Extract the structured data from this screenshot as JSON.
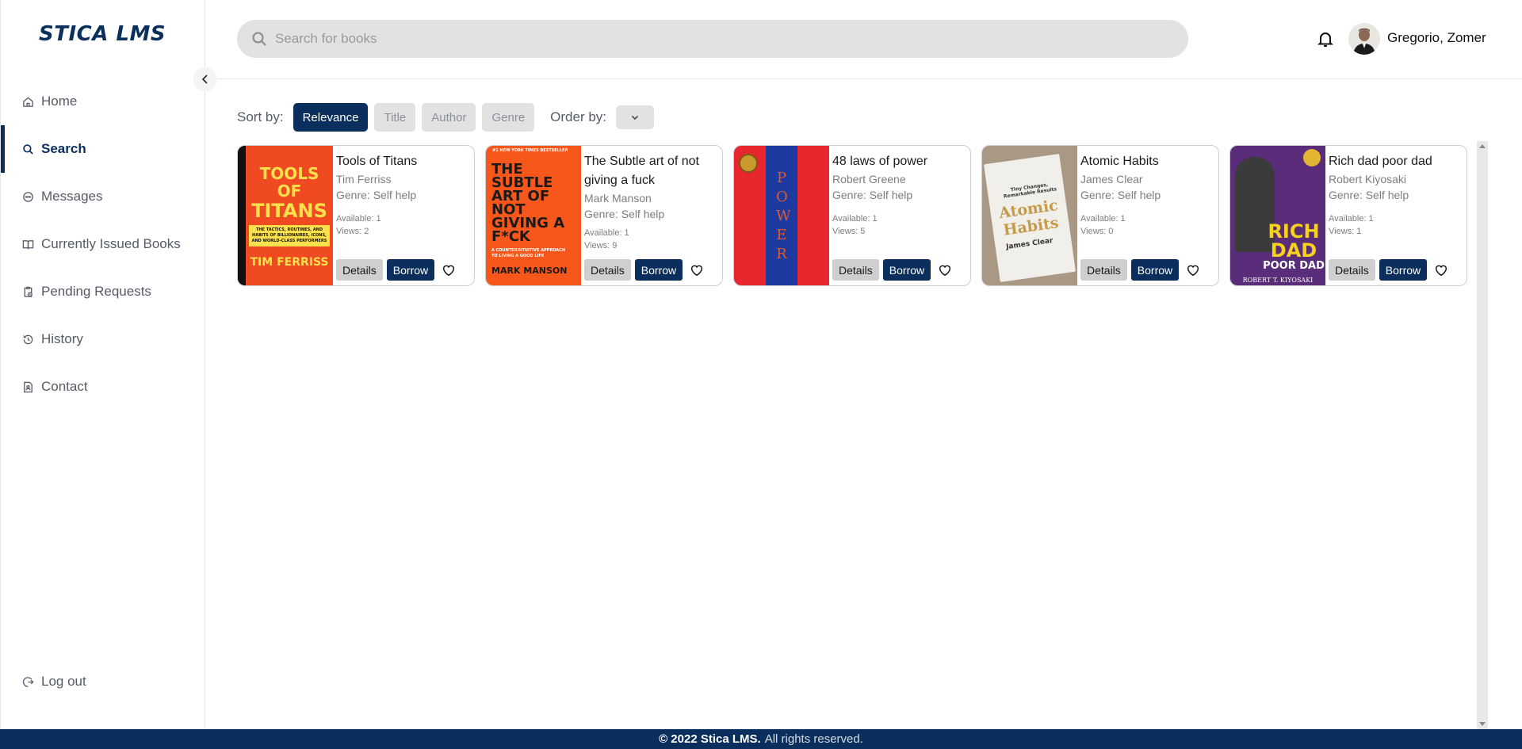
{
  "app": {
    "logo": "STICA LMS"
  },
  "sidebar": {
    "items": [
      {
        "label": "Home",
        "icon": "home-icon"
      },
      {
        "label": "Search",
        "icon": "search-icon",
        "active": true
      },
      {
        "label": "Messages",
        "icon": "message-icon"
      },
      {
        "label": "Currently Issued Books",
        "icon": "book-open-icon"
      },
      {
        "label": "Pending Requests",
        "icon": "clipboard-clock-icon"
      },
      {
        "label": "History",
        "icon": "history-icon"
      },
      {
        "label": "Contact",
        "icon": "contact-file-icon"
      }
    ],
    "logout": "Log out"
  },
  "header": {
    "search_placeholder": "Search for books",
    "user_name": "Gregorio, Zomer"
  },
  "sort": {
    "label": "Sort by:",
    "options": [
      "Relevance",
      "Title",
      "Author",
      "Genre"
    ],
    "active": "Relevance",
    "order_label": "Order by:"
  },
  "books": [
    {
      "title": "Tools of Titans",
      "author": "Tim Ferriss",
      "genre": "Genre: Self help",
      "available": "Available: 1",
      "views": "Views: 2",
      "cover": {
        "top": "TOOLS OF",
        "main": "TITANS",
        "sub": "THE TACTICS, ROUTINES, AND HABITS OF BILLIONAIRES, ICONS, AND WORLD-CLASS PERFORMERS",
        "bottom": "TIM FERRISS"
      }
    },
    {
      "title": "The Subtle art of not giving a fuck",
      "author": "Mark Manson",
      "genre": "Genre: Self help",
      "available": "Available: 1",
      "views": "Views: 9",
      "cover": {
        "top": "#1 NEW YORK TIMES BESTSELLER",
        "main": "THE SUBTLE ART OF NOT GIVING A F*CK",
        "sub": "A COUNTERINTUITIVE APPROACH TO LIVING A GOOD LIFE",
        "bottom": "MARK MANSON"
      }
    },
    {
      "title": "48 laws of power",
      "author": "Robert Greene",
      "genre": "Genre: Self help",
      "available": "Available: 1",
      "views": "Views: 5",
      "cover": {
        "main": "POWER"
      }
    },
    {
      "title": "Atomic Habits",
      "author": "James Clear",
      "genre": "Genre: Self help",
      "available": "Available: 1",
      "views": "Views: 0",
      "cover": {
        "top": "Tiny Changes, Remarkable Results",
        "main": "Atomic Habits",
        "bottom": "James Clear"
      }
    },
    {
      "title": "Rich dad poor dad",
      "author": "Robert Kiyosaki",
      "genre": "Genre: Self help",
      "available": "Available: 1",
      "views": "Views: 1",
      "cover": {
        "main": "RICH DAD",
        "sub": "POOR DAD",
        "bottom": "ROBERT T. KIYOSAKI"
      }
    }
  ],
  "card_actions": {
    "details": "Details",
    "borrow": "Borrow"
  },
  "footer": {
    "brand": "© 2022 Stica LMS.",
    "rest": "All rights reserved."
  },
  "colors": {
    "primary": "#0b2f5c",
    "chip": "#e2e2e2",
    "search_bg": "#e2e2e2"
  }
}
